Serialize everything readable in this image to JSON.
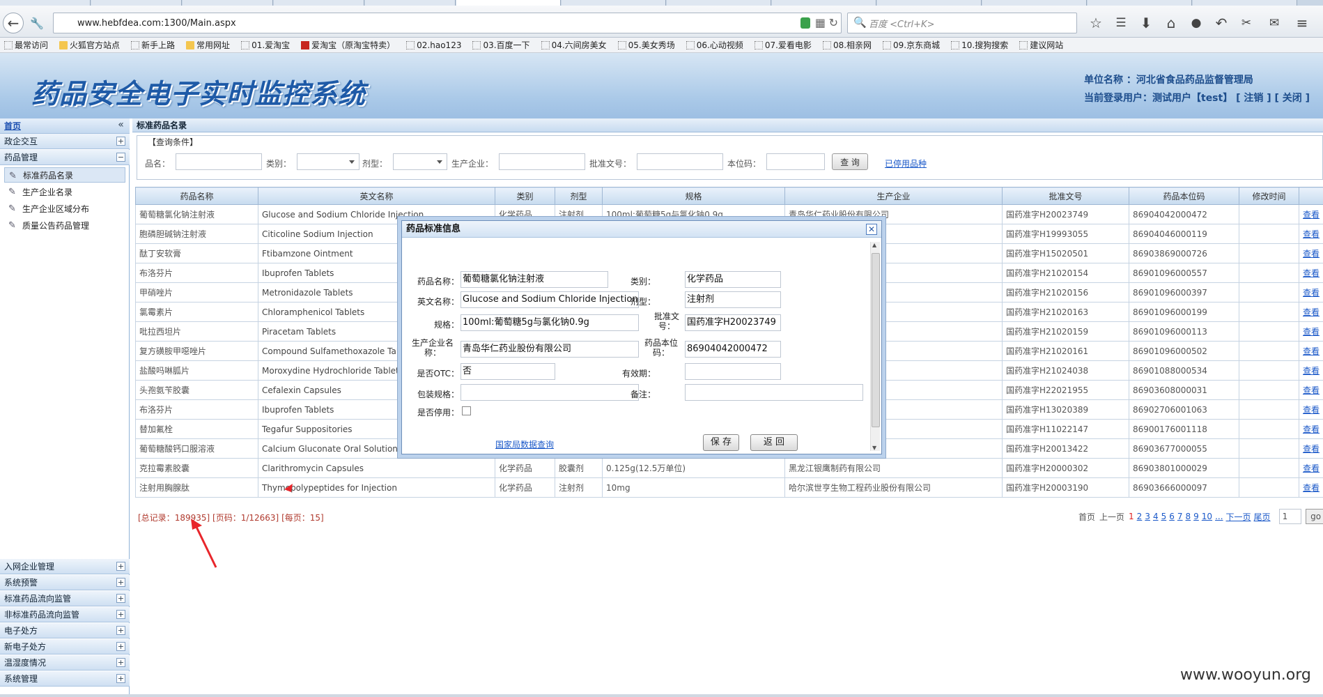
{
  "browser": {
    "url": "www.hebfdea.com:1300/Main.aspx",
    "search_placeholder": "百度 <Ctrl+K>",
    "bookmarks": [
      {
        "label": "最常访问",
        "icon": "settings-icon"
      },
      {
        "label": "火狐官方站点",
        "icon": "folder-icon"
      },
      {
        "label": "新手上路",
        "icon": "page-icon"
      },
      {
        "label": "常用网址",
        "icon": "folder-icon"
      },
      {
        "label": "01.爱淘宝",
        "icon": "page-icon"
      },
      {
        "label": "爱淘宝（原淘宝特卖）",
        "icon": "taobao-icon"
      },
      {
        "label": "02.hao123",
        "icon": "page-icon"
      },
      {
        "label": "03.百度一下",
        "icon": "page-icon"
      },
      {
        "label": "04.六间房美女",
        "icon": "page-icon"
      },
      {
        "label": "05.美女秀场",
        "icon": "page-icon"
      },
      {
        "label": "06.心动视频",
        "icon": "page-icon"
      },
      {
        "label": "07.爱看电影",
        "icon": "page-icon"
      },
      {
        "label": "08.相亲网",
        "icon": "page-icon"
      },
      {
        "label": "09.京东商城",
        "icon": "page-icon"
      },
      {
        "label": "10.搜狗搜索",
        "icon": "page-icon"
      },
      {
        "label": "建议网站",
        "icon": "page-icon"
      }
    ]
  },
  "header": {
    "logo_text": "药品安全电子实时监控系统",
    "unit": "单位名称 ：河北省食品药品监督管理局",
    "login_prefix": "当前登录用户：测试用户【test】",
    "logout": "[ 注销 ]",
    "close": "[ 关闭 ]"
  },
  "sidebar": {
    "home": "首页",
    "top_groups": [
      {
        "label": "政企交互",
        "toggle": "+"
      },
      {
        "label": "药品管理",
        "toggle": "−"
      }
    ],
    "items": [
      "标准药品名录",
      "生产企业名录",
      "生产企业区域分布",
      "质量公告药品管理"
    ],
    "bottom_groups": [
      "入网企业管理",
      "系统预警",
      "标准药品流向监管",
      "非标准药品流向监管",
      "电子处方",
      "新电子处方",
      "温湿度情况",
      "系统管理"
    ],
    "plus": "+"
  },
  "main": {
    "title": "标准药品名录",
    "query": {
      "legend": "【查询条件】",
      "labels": [
        "品名：",
        "类别：",
        "剂型：",
        "生产企业：",
        "批准文号：",
        "本位码："
      ],
      "button": "查 询",
      "link": "已停用品种"
    },
    "columns": [
      "药品名称",
      "英文名称",
      "类别",
      "剂型",
      "规格",
      "生产企业",
      "批准文号",
      "药品本位码",
      "修改时间",
      ""
    ],
    "rows": [
      [
        "葡萄糖氯化钠注射液",
        "Glucose and Sodium Chloride Injection",
        "化学药品",
        "注射剂",
        "100ml:葡萄糖5g与氯化钠0.9g",
        "青岛华仁药业股份有限公司",
        "国药准字H20023749",
        "86904042000472",
        "",
        "查看"
      ],
      [
        "胞磷胆碱钠注射液",
        "Citicoline Sodium Injection",
        "",
        "",
        "",
        "",
        "国药准字H19993055",
        "86904046000119",
        "",
        "查看"
      ],
      [
        "酞丁安软膏",
        "Ftibamzone Ointment",
        "",
        "",
        "",
        "",
        "国药准字H15020501",
        "86903869000726",
        "",
        "查看"
      ],
      [
        "布洛芬片",
        "Ibuprofen Tablets",
        "",
        "",
        "",
        "",
        "国药准字H21020154",
        "86901096000557",
        "",
        "查看"
      ],
      [
        "甲硝唑片",
        "Metronidazole Tablets",
        "",
        "",
        "",
        "",
        "国药准字H21020156",
        "86901096000397",
        "",
        "查看"
      ],
      [
        "氯霉素片",
        "Chloramphenicol Tablets",
        "",
        "",
        "",
        "",
        "国药准字H21020163",
        "86901096000199",
        "",
        "查看"
      ],
      [
        "吡拉西坦片",
        "Piracetam Tablets",
        "",
        "",
        "",
        "",
        "国药准字H21020159",
        "86901096000113",
        "",
        "查看"
      ],
      [
        "复方磺胺甲噁唑片",
        "Compound Sulfamethoxazole Tab",
        "",
        "",
        "",
        "",
        "国药准字H21020161",
        "86901096000502",
        "",
        "查看"
      ],
      [
        "盐酸吗啉胍片",
        "Moroxydine Hydrochloride Tablet",
        "",
        "",
        "",
        "",
        "国药准字H21024038",
        "86901088000534",
        "",
        "查看"
      ],
      [
        "头孢氨苄胶囊",
        "Cefalexin Capsules",
        "",
        "",
        "",
        "司",
        "国药准字H22021955",
        "86903608000031",
        "",
        "查看"
      ],
      [
        "布洛芬片",
        "Ibuprofen Tablets",
        "",
        "",
        "",
        "",
        "国药准字H13020389",
        "86902706001063",
        "",
        "查看"
      ],
      [
        "替加氟栓",
        "Tegafur Suppositories",
        "",
        "",
        "",
        "",
        "国药准字H11022147",
        "86900176001118",
        "",
        "查看"
      ],
      [
        "葡萄糖酸钙口服溶液",
        "Calcium Gluconate Oral Solution",
        "",
        "",
        "",
        "司",
        "国药准字H20013422",
        "86903677000055",
        "",
        "查看"
      ],
      [
        "克拉霉素胶囊",
        "Clarithromycin Capsules",
        "化学药品",
        "胶囊剂",
        "0.125g(12.5万单位)",
        "黑龙江银鹰制药有限公司",
        "国药准字H20000302",
        "86903801000029",
        "",
        "查看"
      ],
      [
        "注射用胸腺肽",
        "Thymopolypeptides for Injection",
        "化学药品",
        "注射剂",
        "10mg",
        "哈尔滨世亨生物工程药业股份有限公司",
        "国药准字H20003190",
        "86903666000097",
        "",
        "查看"
      ]
    ],
    "pageinfo": {
      "total_label": "[总记录：",
      "total": "189935",
      "total_end": "]",
      "pages": "[页码：1/12663]",
      "per": "[每页：15]"
    },
    "pager": {
      "first": "首页",
      "prev": "上一页",
      "current": "1",
      "pages": [
        "2",
        "3",
        "4",
        "5",
        "6",
        "7",
        "8",
        "9",
        "10",
        "..."
      ],
      "next": "下一页",
      "last": "尾页",
      "input": "1",
      "go": "go"
    }
  },
  "dialog": {
    "title": "药品标准信息",
    "fields": {
      "name_label": "药品名称：",
      "name": "葡萄糖氯化钠注射液",
      "type_label": "类别：",
      "type": "化学药品",
      "en_label": "英文名称：",
      "en": "Glucose and Sodium Chloride Injection",
      "form_label": "剂型：",
      "form": "注射剂",
      "spec_label": "规格：",
      "spec": "100ml:葡萄糖5g与氯化钠0.9g",
      "approval_label": "批准文号：",
      "approval": "国药准字H20023749",
      "maker_label": "生产企业名称：",
      "maker": "青岛华仁药业股份有限公司",
      "code_label": "药品本位码：",
      "code": "86904042000472",
      "otc_label": "是否OTC：",
      "otc": "否",
      "expiry_label": "有效期：",
      "expiry": "",
      "pack_label": "包装规格：",
      "pack": "",
      "note_label": "备注：",
      "note": "",
      "disabled_label": "是否停用："
    },
    "link": "国家局数据查询",
    "save": "保 存",
    "back": "返 回"
  },
  "watermark": "www.wooyun.org",
  "colors": {
    "accent": "#1b59c9",
    "annotation": "#e8262b",
    "header_bg": "#aac9e8"
  }
}
